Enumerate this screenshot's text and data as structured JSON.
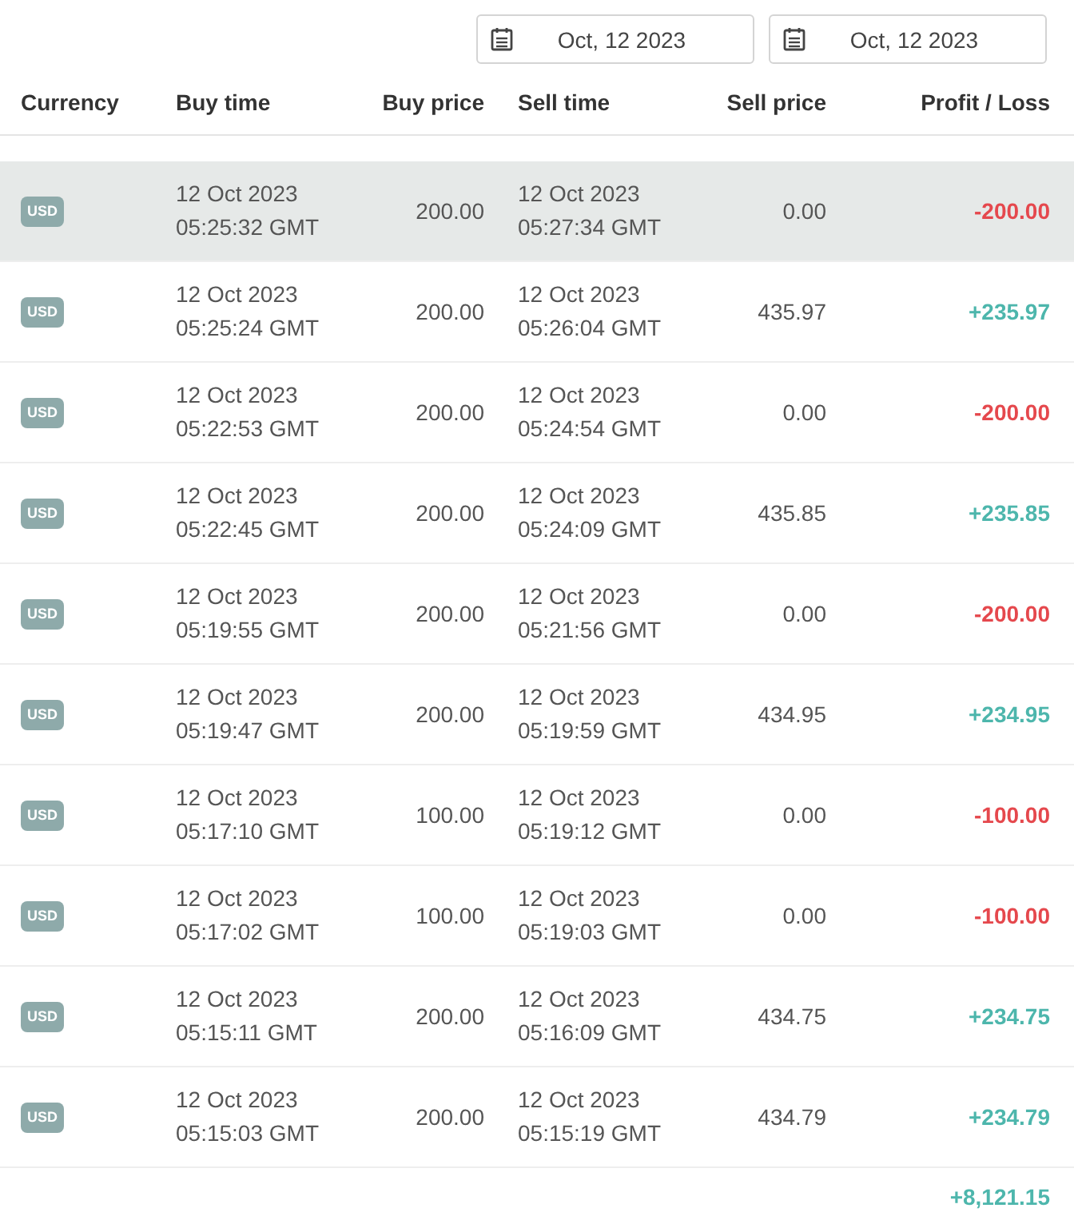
{
  "date_filters": [
    {
      "value": "Oct, 12 2023"
    },
    {
      "value": "Oct, 12 2023"
    }
  ],
  "table": {
    "columns": [
      "Currency",
      "Buy time",
      "Buy price",
      "Sell time",
      "Sell price",
      "Profit / Loss"
    ],
    "rows": [
      {
        "selected": true,
        "currency": "USD",
        "buy_date": "12 Oct 2023",
        "buy_time": "05:25:32 GMT",
        "buy_price": "200.00",
        "sell_date": "12 Oct 2023",
        "sell_time": "05:27:34 GMT",
        "sell_price": "0.00",
        "result": "-200.00",
        "kind": "loss"
      },
      {
        "selected": false,
        "currency": "USD",
        "buy_date": "12 Oct 2023",
        "buy_time": "05:25:24 GMT",
        "buy_price": "200.00",
        "sell_date": "12 Oct 2023",
        "sell_time": "05:26:04 GMT",
        "sell_price": "435.97",
        "result": "+235.97",
        "kind": "profit"
      },
      {
        "selected": false,
        "currency": "USD",
        "buy_date": "12 Oct 2023",
        "buy_time": "05:22:53 GMT",
        "buy_price": "200.00",
        "sell_date": "12 Oct 2023",
        "sell_time": "05:24:54 GMT",
        "sell_price": "0.00",
        "result": "-200.00",
        "kind": "loss"
      },
      {
        "selected": false,
        "currency": "USD",
        "buy_date": "12 Oct 2023",
        "buy_time": "05:22:45 GMT",
        "buy_price": "200.00",
        "sell_date": "12 Oct 2023",
        "sell_time": "05:24:09 GMT",
        "sell_price": "435.85",
        "result": "+235.85",
        "kind": "profit"
      },
      {
        "selected": false,
        "currency": "USD",
        "buy_date": "12 Oct 2023",
        "buy_time": "05:19:55 GMT",
        "buy_price": "200.00",
        "sell_date": "12 Oct 2023",
        "sell_time": "05:21:56 GMT",
        "sell_price": "0.00",
        "result": "-200.00",
        "kind": "loss"
      },
      {
        "selected": false,
        "currency": "USD",
        "buy_date": "12 Oct 2023",
        "buy_time": "05:19:47 GMT",
        "buy_price": "200.00",
        "sell_date": "12 Oct 2023",
        "sell_time": "05:19:59 GMT",
        "sell_price": "434.95",
        "result": "+234.95",
        "kind": "profit"
      },
      {
        "selected": false,
        "currency": "USD",
        "buy_date": "12 Oct 2023",
        "buy_time": "05:17:10 GMT",
        "buy_price": "100.00",
        "sell_date": "12 Oct 2023",
        "sell_time": "05:19:12 GMT",
        "sell_price": "0.00",
        "result": "-100.00",
        "kind": "loss"
      },
      {
        "selected": false,
        "currency": "USD",
        "buy_date": "12 Oct 2023",
        "buy_time": "05:17:02 GMT",
        "buy_price": "100.00",
        "sell_date": "12 Oct 2023",
        "sell_time": "05:19:03 GMT",
        "sell_price": "0.00",
        "result": "-100.00",
        "kind": "loss"
      },
      {
        "selected": false,
        "currency": "USD",
        "buy_date": "12 Oct 2023",
        "buy_time": "05:15:11 GMT",
        "buy_price": "200.00",
        "sell_date": "12 Oct 2023",
        "sell_time": "05:16:09 GMT",
        "sell_price": "434.75",
        "result": "+234.75",
        "kind": "profit"
      },
      {
        "selected": false,
        "currency": "USD",
        "buy_date": "12 Oct 2023",
        "buy_time": "05:15:03 GMT",
        "buy_price": "200.00",
        "sell_date": "12 Oct 2023",
        "sell_time": "05:15:19 GMT",
        "sell_price": "434.79",
        "result": "+234.79",
        "kind": "profit"
      }
    ],
    "total": {
      "value": "+8,121.15",
      "kind": "profit"
    }
  }
}
